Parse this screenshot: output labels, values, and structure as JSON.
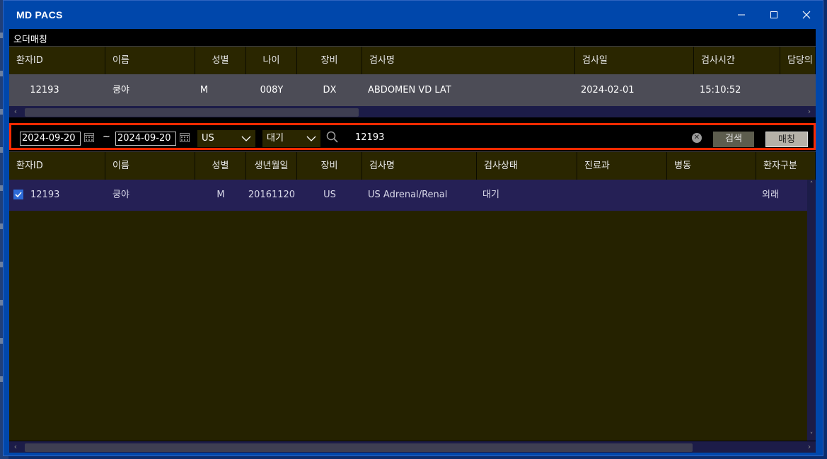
{
  "window": {
    "title": "MD PACS",
    "controls": {
      "minimize": "—",
      "maximize": "☐",
      "close": "✕"
    }
  },
  "section_label": "오더매칭",
  "order_grid": {
    "columns": [
      "환자ID",
      "이름",
      "성별",
      "나이",
      "장비",
      "검사명",
      "검사일",
      "검사시간",
      "담당의"
    ],
    "rows": [
      {
        "patient_id": "12193",
        "name": "쿵야",
        "sex": "M",
        "age": "008Y",
        "modality": "DX",
        "exam": "ABDOMEN VD LAT",
        "date": "2024-02-01",
        "time": "15:10:52",
        "doctor": ""
      }
    ],
    "scroll": {
      "thumb_fraction": 0.43
    }
  },
  "filter": {
    "date_from": "2024-09-20",
    "tilde": "~",
    "date_to": "2024-09-20",
    "modality_select": "US",
    "status_select": "대기",
    "search_value": "12193",
    "clear_icon": "✕",
    "search_button": "검색",
    "match_button": "매칭",
    "highlight_color": "#ff2a00"
  },
  "worklist_grid": {
    "columns": [
      "환자ID",
      "이름",
      "성별",
      "생년월일",
      "장비",
      "검사명",
      "검사상태",
      "진료과",
      "병동",
      "환자구분"
    ],
    "rows": [
      {
        "checked": true,
        "patient_id": "12193",
        "name": "쿵야",
        "sex": "M",
        "birth": "20161120",
        "modality": "US",
        "exam": "US Adrenal/Renal",
        "status": "대기",
        "dept": "",
        "ward": "",
        "patient_type": "외래"
      }
    ],
    "scroll": {
      "thumb_fraction": 0.85
    }
  },
  "colors": {
    "titlebar": "#0047ab",
    "grid_header": "#2a2600",
    "selected_row": "#4c4c56",
    "worklist_row": "#252055",
    "checkbox": "#2d6bd8"
  }
}
